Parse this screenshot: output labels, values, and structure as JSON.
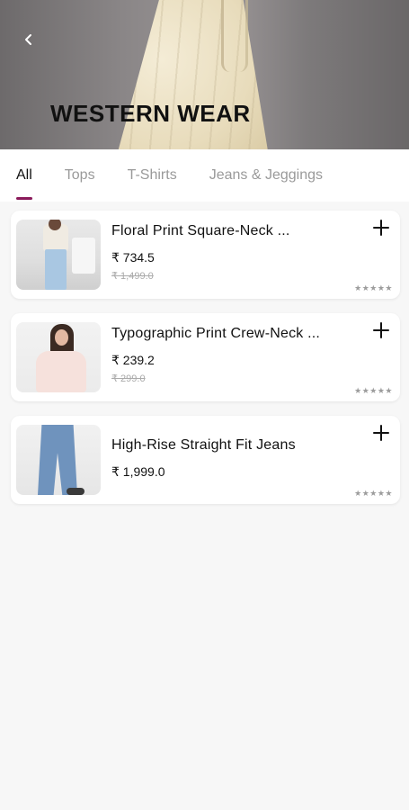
{
  "header": {
    "title": "WESTERN WEAR",
    "back_icon": "chevron-left-icon"
  },
  "tabs": [
    {
      "label": "All",
      "active": true
    },
    {
      "label": "Tops",
      "active": false
    },
    {
      "label": "T-Shirts",
      "active": false
    },
    {
      "label": "Jeans & Jeggings",
      "active": false
    }
  ],
  "products": [
    {
      "name": "Floral Print Square-Neck ...",
      "price": "₹ 734.5",
      "mrp": "₹ 1,499.0",
      "rating": "★★★★★"
    },
    {
      "name": "Typographic Print Crew-Neck ...",
      "price": "₹ 239.2",
      "mrp": "₹ 299.0",
      "rating": "★★★★★"
    },
    {
      "name": "High-Rise Straight Fit Jeans",
      "price": "₹ 1,999.0",
      "mrp": "",
      "rating": "★★★★★"
    }
  ],
  "colors": {
    "accent": "#8a1a5a",
    "background": "#f7f7f7"
  }
}
